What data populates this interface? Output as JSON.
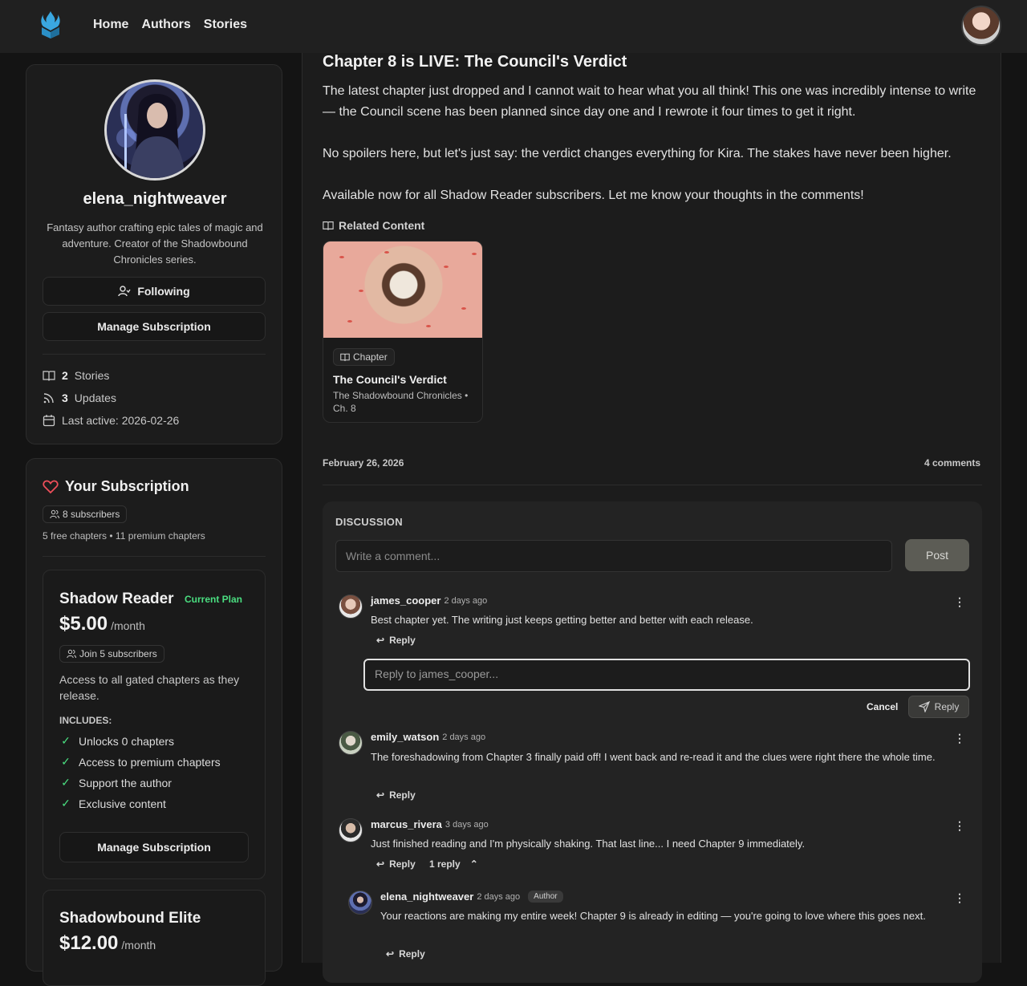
{
  "nav": {
    "home": "Home",
    "authors": "Authors",
    "stories": "Stories"
  },
  "profile": {
    "name": "elena_nightweaver",
    "bio": "Fantasy author crafting epic tales of magic and adventure. Creator of the Shadowbound Chronicles series.",
    "follow_label": "Following",
    "manage_label": "Manage Subscription",
    "stories_count": "2",
    "stories_label": "Stories",
    "updates_count": "3",
    "updates_label": "Updates",
    "last_active": "Last active: 2026-02-26"
  },
  "subscription": {
    "title": "Your Subscription",
    "subscribers": "8 subscribers",
    "meta": "5 free chapters • 11 premium chapters",
    "plans": [
      {
        "name": "Shadow Reader",
        "current_label": "Current Plan",
        "price": "$5.00",
        "period": "/month",
        "join": "Join 5 subscribers",
        "description": "Access to all gated chapters as they release.",
        "includes_label": "INCLUDES:",
        "features": [
          "Unlocks 0 chapters",
          "Access to premium chapters",
          "Support the author",
          "Exclusive content"
        ],
        "button": "Manage Subscription"
      },
      {
        "name": "Shadowbound Elite",
        "price": "$12.00",
        "period": "/month"
      }
    ]
  },
  "post": {
    "title": "Chapter 8 is LIVE: The Council's Verdict",
    "paragraphs": [
      "The latest chapter just dropped and I cannot wait to hear what you all think! This one was incredibly intense to write — the Council scene has been planned since day one and I rewrote it four times to get it right.",
      "No spoilers here, but let's just say: the verdict changes everything for Kira. The stakes have never been higher.",
      "Available now for all Shadow Reader subscribers. Let me know your thoughts in the comments!"
    ],
    "related_label": "Related Content",
    "related": {
      "tag": "Chapter",
      "title": "The Council's Verdict",
      "subtitle": "The Shadowbound Chronicles • Ch. 8"
    },
    "date": "February 26, 2026",
    "comments_count": "4 comments"
  },
  "discussion": {
    "label": "DISCUSSION",
    "placeholder": "Write a comment...",
    "post_label": "Post",
    "reply_placeholder": "Reply to james_cooper...",
    "cancel_label": "Cancel",
    "reply_button": "Reply",
    "comments": [
      {
        "user": "james_cooper",
        "time": "2 days ago",
        "text": "Best chapter yet. The writing just keeps getting better and better with each release.",
        "reply": "Reply"
      },
      {
        "user": "emily_watson",
        "time": "2 days ago",
        "text": "The foreshadowing from Chapter 3 finally paid off! I went back and re-read it and the clues were right there the whole time.",
        "reply": "Reply"
      },
      {
        "user": "marcus_rivera",
        "time": "3 days ago",
        "text": "Just finished reading and I'm physically shaking. That last line... I need Chapter 9 immediately.",
        "reply": "Reply",
        "replies_label": "1 reply"
      },
      {
        "user": "elena_nightweaver",
        "time": "2 days ago",
        "badge": "Author",
        "text": "Your reactions are making my entire week! Chapter 9 is already in editing — you're going to love where this goes next.",
        "reply": "Reply"
      }
    ]
  }
}
